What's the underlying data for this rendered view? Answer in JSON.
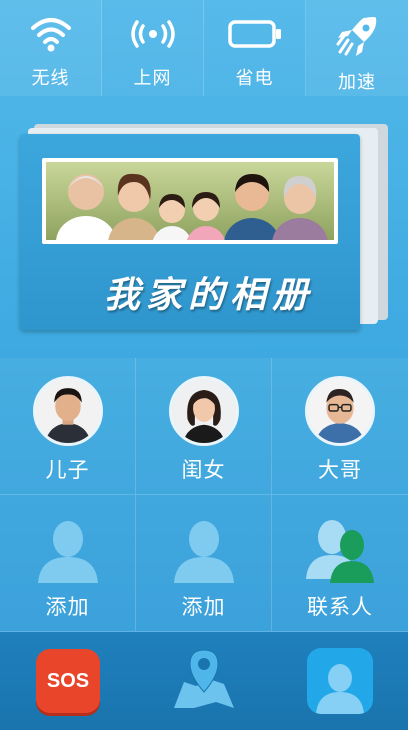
{
  "toggles": [
    {
      "label": "无线",
      "icon": "wifi-icon"
    },
    {
      "label": "上网",
      "icon": "signal-icon"
    },
    {
      "label": "省电",
      "icon": "battery-icon"
    },
    {
      "label": "加速",
      "icon": "rocket-icon"
    }
  ],
  "album": {
    "title": "我家的相册"
  },
  "contacts": [
    {
      "name": "儿子",
      "type": "photo"
    },
    {
      "name": "闺女",
      "type": "photo"
    },
    {
      "name": "大哥",
      "type": "photo"
    },
    {
      "name": "添加",
      "type": "add"
    },
    {
      "name": "添加",
      "type": "add"
    },
    {
      "name": "联系人",
      "type": "contacts"
    }
  ],
  "dock": {
    "sos_label": "SOS",
    "icons": [
      "sos-icon",
      "map-location-icon",
      "contact-icon"
    ]
  },
  "colors": {
    "background": "#3aa7df",
    "dock": "#1f80bd",
    "sos": "#e8452b",
    "contacts_green": "#1a9d5a"
  }
}
